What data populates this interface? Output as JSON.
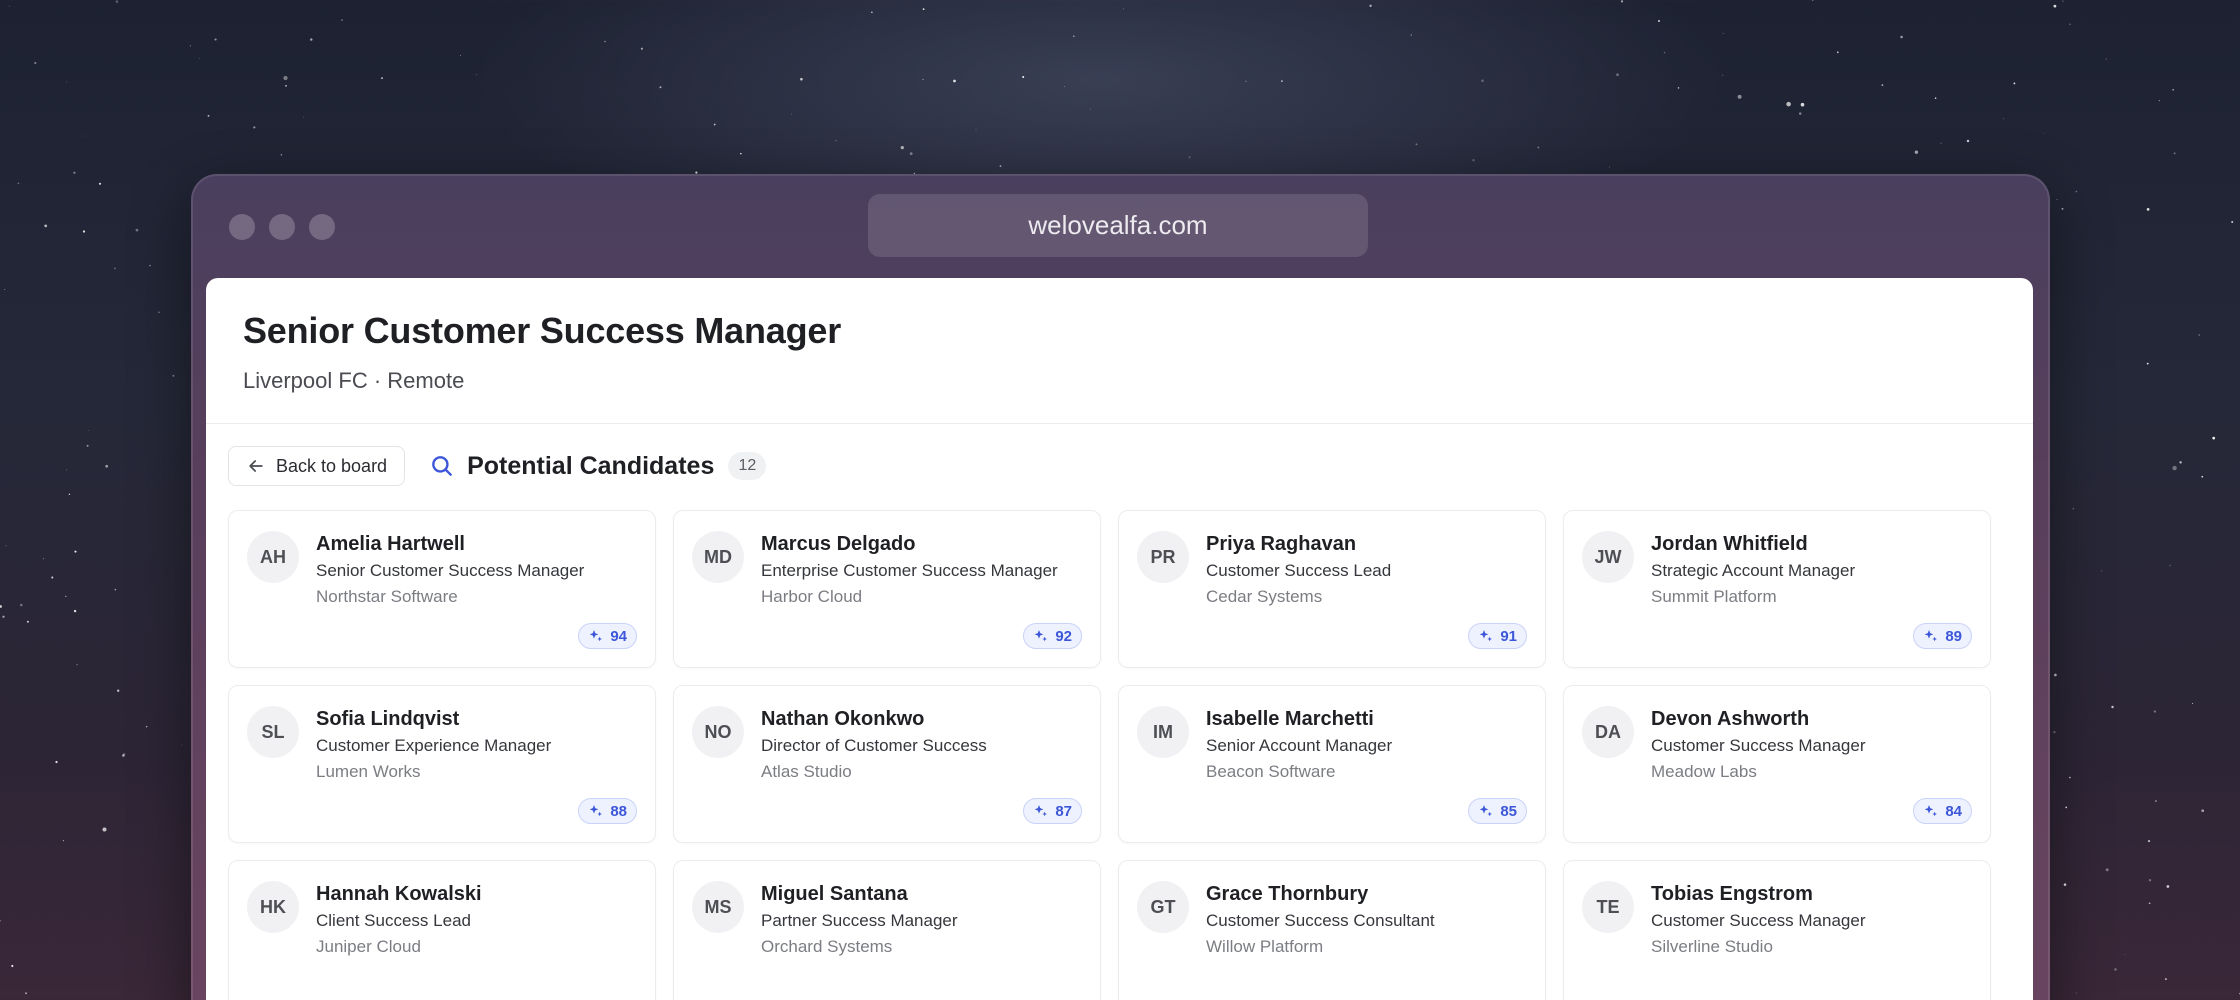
{
  "browser": {
    "url": "welovealfa.com"
  },
  "job": {
    "title": "Senior Customer Success Manager",
    "meta": "Liverpool FC · Remote"
  },
  "toolbar": {
    "back_label": "Back to board",
    "section_title": "Potential Candidates",
    "count": "12"
  },
  "colors": {
    "accent": "#3d57d8",
    "accent_bg": "#eef2ff"
  },
  "icons": {
    "back": "arrow-left-icon",
    "search": "search-icon",
    "score": "sparkle-icon"
  },
  "candidates": [
    {
      "initials": "AH",
      "name": "Amelia Hartwell",
      "role": "Senior Customer Success Manager",
      "company": "Northstar Software",
      "score": "94"
    },
    {
      "initials": "MD",
      "name": "Marcus Delgado",
      "role": "Enterprise Customer Success Manager",
      "company": "Harbor Cloud",
      "score": "92"
    },
    {
      "initials": "PR",
      "name": "Priya Raghavan",
      "role": "Customer Success Lead",
      "company": "Cedar Systems",
      "score": "91"
    },
    {
      "initials": "JW",
      "name": "Jordan Whitfield",
      "role": "Strategic Account Manager",
      "company": "Summit Platform",
      "score": "89"
    },
    {
      "initials": "SL",
      "name": "Sofia Lindqvist",
      "role": "Customer Experience Manager",
      "company": "Lumen Works",
      "score": "88"
    },
    {
      "initials": "NO",
      "name": "Nathan Okonkwo",
      "role": "Director of Customer Success",
      "company": "Atlas Studio",
      "score": "87"
    },
    {
      "initials": "IM",
      "name": "Isabelle Marchetti",
      "role": "Senior Account Manager",
      "company": "Beacon Software",
      "score": "85"
    },
    {
      "initials": "DA",
      "name": "Devon Ashworth",
      "role": "Customer Success Manager",
      "company": "Meadow Labs",
      "score": "84"
    },
    {
      "initials": "HK",
      "name": "Hannah Kowalski",
      "role": "Client Success Lead",
      "company": "Juniper Cloud",
      "score": ""
    },
    {
      "initials": "MS",
      "name": "Miguel Santana",
      "role": "Partner Success Manager",
      "company": "Orchard Systems",
      "score": ""
    },
    {
      "initials": "GT",
      "name": "Grace Thornbury",
      "role": "Customer Success Consultant",
      "company": "Willow Platform",
      "score": ""
    },
    {
      "initials": "TE",
      "name": "Tobias Engstrom",
      "role": "Customer Success Manager",
      "company": "Silverline Studio",
      "score": ""
    }
  ]
}
